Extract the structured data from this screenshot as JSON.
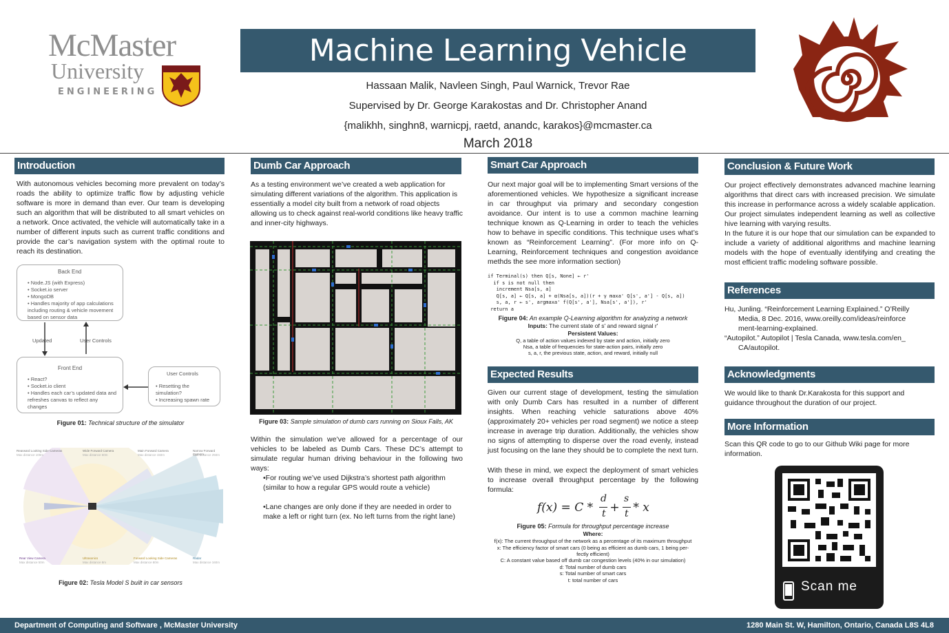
{
  "logo": {
    "line1": "McMaster",
    "line2": "University",
    "line3": "ENGINEERING"
  },
  "title": "Machine Learning Vehicle Simulator",
  "authors": "Hassaan Malik, Navleen Singh, Paul Warnick, Trevor Rae",
  "supervisors": "Supervised by Dr. George Karakostas and Dr. Christopher Anand",
  "emails": "{malikhh, singhn8, warnicpj, raetd, anandc, karakos}@mcmaster.ca",
  "date": "March 2018",
  "intro": {
    "heading": "Introduction",
    "text": "With autonomous vehicles becoming more prevalent on today’s roads the ability to optimize traffic flow by adjusting vehicle software is more in demand than ever. Our team is developing such an algorithm that will be distributed to all smart vehicles on a network. Once activated, the vehicle will automatically take in a number of different inputs such as current traffic conditions and provide the car’s navigation system with the optimal route to reach its destination."
  },
  "fig1": {
    "backend_title": "Back End",
    "backend_items": [
      "• Node.JS (with Express)",
      "• Socket.io server",
      "• MongoDB",
      "• Handles majority of app calculations",
      "   including routing & vehicle movement",
      "   based on sensor data"
    ],
    "updated": "Updated",
    "user_controls_arrow": "User Controls",
    "frontend_title": "Front End",
    "frontend_items": [
      "• React?",
      "• Socket.io client",
      "• Handles each car’s updated data and",
      "   refreshes canvas to reflect any",
      "   changes"
    ],
    "uc_title": "User Controls",
    "uc_items": [
      "• Resetting the",
      "   simulation?",
      "• Increasing spawn rate"
    ],
    "cap_label": "Figure 01:",
    "cap_text": " Technical structure of the simulator"
  },
  "fig2": {
    "cap_label": "Figure 02:",
    "cap_text": " Tesla Model S built in car sensors",
    "top_labels": [
      "Rearward Looking Side Cameras",
      "Wide Forward Camera",
      "Main Forward Camera",
      "Narrow Forward Camera"
    ],
    "top_sub": [
      "Max distance 100m",
      "Max distance 60m",
      "Max distance 150m",
      "Max distance 250m"
    ],
    "bottom_labels": [
      "Rear View Camera",
      "Ultrasonics",
      "Forward Looking Side Cameras",
      "Radar"
    ],
    "bottom_sub": [
      "Max distance 50m",
      "Max distance 8m",
      "Max distance 80m",
      "Max distance 160m"
    ]
  },
  "dumb": {
    "heading": "Dumb Car Approach",
    "text1": "As a testing environment we’ve created a web application for simulating different variations of the algorithm. This application is essentially a model city built from a network of road objects allowing us to check against real-world conditions like heavy traffic and inner-city highways.",
    "cap_label": "Figure 03:",
    "cap_text": " Sample simulation of dumb cars running on Sioux Falls, AK",
    "text2": "Within the simulation we’ve allowed for a percentage of our vehicles to be labeled as Dumb Cars. These DC’s attempt to simulate regular human driving behaviour in the following two ways:",
    "bullet1": "•For routing we’ve used Dijkstra’s shortest path algorithm (similar to how a regular GPS would route a vehicle)",
    "bullet2": "•Lane changes are only done if they are needed in order to make a left or right turn (ex. No left turns from the right lane)"
  },
  "smart": {
    "heading": "Smart Car Approach",
    "text": "Our next major goal will be to implementing Smart versions of the aforementioned vehicles. We hypothesize a significant increase in car throughput via primary and secondary congestion avoidance. Our intent is to use a common machine learning technique known as Q-Learning in order to teach the vehicles how to behave in specific conditions. This technique uses what’s known as “Reinforcement Learning”. (For more info on Q-Learning, Reinforcement techniques and congestion avoidance methds the see more information section)",
    "code": "if Terminal(s) then Q[s, None] ← r'\n  if s is not null then\n   increment Nsa[s, a]\n   Q[s, a] ← Q[s, a] + α(Nsa[s, a])(r + γ maxa' Q[s', a'] - Q[s, a])\n   s, a, r ← s', argmaxa' f(Q[s', a'], Nsa[s', a']), r'\n return a",
    "cap_label": "Figure 04:",
    "cap_text": "  An example Q-Learning algorithm for analyzing a network",
    "inputs_label": "Inputs:",
    "inputs_text": " The current state of s' and reward signal r'",
    "persist": "Persistent Values:",
    "pv1": "Q, a table of action values indexed by state and action, initially zero",
    "pv2": "Nsa, a table of frequencies for state-action pairs, initially zero",
    "pv3": "s, a, r, the previous state, action, and reward, initially null"
  },
  "expected": {
    "heading": "Expected Results",
    "text1": "Given our current stage of development, testing the simulation with only Dumb Cars has resulted in a number of different insights. When reaching vehicle saturations above 40% (approximately 20+ vehicles per road segment) we notice a steep increase in average trip duration. Additionally, the vehicles show no signs of attempting to disperse over the road evenly, instead just focusing on the lane they should be to complete the next turn.",
    "text2": "With these in mind, we expect the deployment of smart vehicles to increase overall throughput percentage by the following formula:",
    "formula_lhs": "f(x) = C * ",
    "d": "d",
    "t": "t",
    "plus": " + ",
    "s": "s",
    "times_x": " * x",
    "cap_label": "Figure 05:",
    "cap_text": "  Formula for throughput percentage increase",
    "where": "Where:",
    "w1": "f(x): The current throughput of the network as a percentage of its maximum throughput",
    "w2": "x:  The efficiency factor of smart cars (0 being as efficient as dumb cars, 1 being per-",
    "w2b": "fectly efficient)",
    "w3": "C: A constant value based off dumb car congestion levels (40% in our simulation)",
    "w4": "d: Total number of dumb cars",
    "w5": "s: Total number of smart cars",
    "w6": "t: total number of cars"
  },
  "conclusion": {
    "heading": "Conclusion & Future Work",
    "text1": "Our project effectively demonstrates  advanced machine learning algorithms that direct cars with increased precision. We simulate this increase in performance across a widely scalable application. Our project simulates independent learning as well as collective hive learning with varying results.",
    "text2": "In the future it is our hope that our simulation can be expanded to include a variety of additional algorithms and machine learning models with the hope of eventually identifying and creating the most efficient traffic modeling software possible."
  },
  "references": {
    "heading": "References",
    "r1a": "Hu, Junling. “Reinforcement Learning Explained.” O’Reilly",
    "r1b": "Media, 8 Dec. 2016, www.oreilly.com/ideas/reinforce",
    "r1c": "ment-learning-explained.",
    "r2a": "“Autopilot.” Autopilot | Tesla Canada, www.tesla.com/en_",
    "r2b": "CA/autopilot."
  },
  "ack": {
    "heading": "Acknowledgments",
    "text": "We would like to thank Dr.Karakosta for this support and guidance throughout the duration of our project."
  },
  "more": {
    "heading": "More Information",
    "text": "Scan this QR code to go to our Github Wiki page for more information.",
    "scan": "Scan me"
  },
  "footer": {
    "left": "Department of Computing and Software , McMaster University",
    "right": "1280 Main St. W, Hamilton, Ontario, Canada L8S 4L8"
  },
  "colors": {
    "accent": "#35596e",
    "spiral": "#8a2513"
  }
}
